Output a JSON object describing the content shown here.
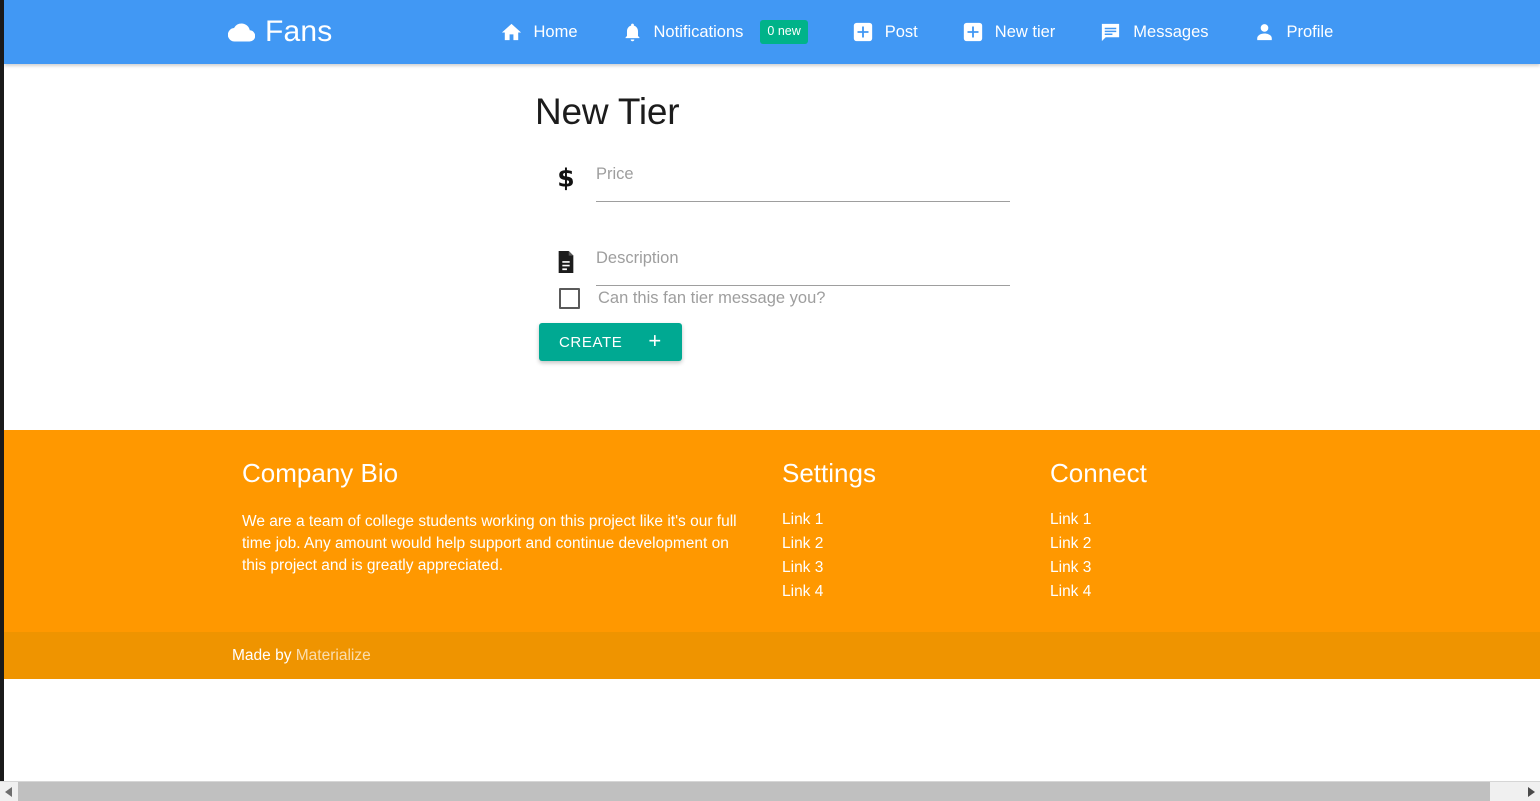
{
  "navbar": {
    "brand": {
      "logo_icon": "cloud-icon",
      "label": "Fans"
    },
    "accent_color": "#4198f4",
    "items": [
      {
        "icon": "home-icon",
        "label": "Home"
      },
      {
        "icon": "bell-icon",
        "label": "Notifications",
        "badge": "0 new",
        "badge_color": "#00b389"
      },
      {
        "icon": "plus-box-icon",
        "label": "Post"
      },
      {
        "icon": "plus-box-icon",
        "label": "New tier"
      },
      {
        "icon": "chat-icon",
        "label": "Messages"
      },
      {
        "icon": "person-icon",
        "label": "Profile"
      }
    ]
  },
  "main": {
    "title": "New Tier",
    "fields": [
      {
        "icon": "dollar-icon",
        "glyph": "$",
        "placeholder": "Price",
        "value": ""
      },
      {
        "icon": "description-icon",
        "placeholder": "Description",
        "value": ""
      }
    ],
    "checkbox": {
      "label": "Can this fan tier message you?",
      "checked": false
    },
    "submit": {
      "label": "CREATE",
      "icon": "plus-icon",
      "glyph": "+",
      "color": "#00a992"
    }
  },
  "footer": {
    "background_color": "#ff9800",
    "bio": {
      "title": "Company Bio",
      "text": "We are a team of college students working on this project like it's our full time job. Any amount would help support and continue development on this project and is greatly appreciated."
    },
    "settings": {
      "title": "Settings",
      "links": [
        "Link 1",
        "Link 2",
        "Link 3",
        "Link 4"
      ]
    },
    "connect": {
      "title": "Connect",
      "links": [
        "Link 1",
        "Link 2",
        "Link 3",
        "Link 4"
      ]
    },
    "copyright": {
      "prefix": "Made by ",
      "link_label": "Materialize",
      "background_color": "#ef9400"
    }
  },
  "scrollbar": {
    "left_arrow_icon": "triangle-left-icon",
    "right_arrow_icon": "triangle-right-icon"
  }
}
